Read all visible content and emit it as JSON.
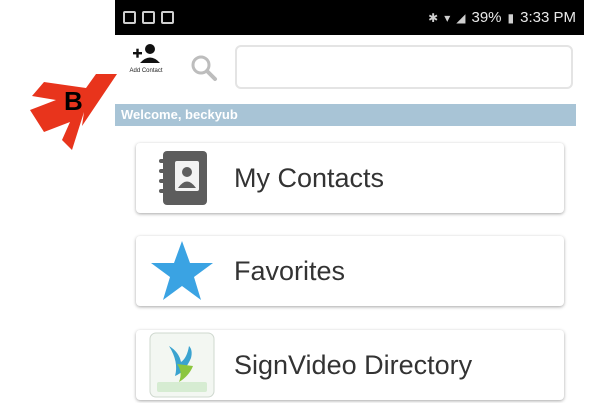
{
  "status_bar": {
    "signal_text": "39%",
    "time": "3:33 PM"
  },
  "toolbar": {
    "add_contact_label": "Add Contact",
    "search_placeholder": ""
  },
  "welcome": {
    "text": "Welcome, beckyub"
  },
  "menu": {
    "items": [
      {
        "label": "My Contacts",
        "icon": "contacts-book-icon"
      },
      {
        "label": "Favorites",
        "icon": "star-icon"
      },
      {
        "label": "SignVideo Directory",
        "icon": "signvideo-logo-icon"
      }
    ]
  },
  "annotation": {
    "letter": "B",
    "arrow_color": "#e8341c"
  },
  "colors": {
    "welcome_bar": "#a8c4d6",
    "star": "#3aa3e3",
    "status_bar": "#000000"
  }
}
